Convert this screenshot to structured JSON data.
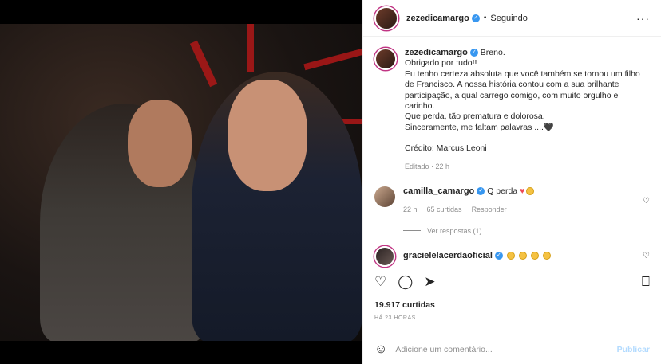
{
  "post_author": {
    "username": "zezedicamargo",
    "follow_status": "Seguindo",
    "separator": "•",
    "more": "···"
  },
  "caption": {
    "username": "zezedicamargo",
    "lines": [
      "Breno.",
      "Obrigado por tudo!!",
      "Eu tenho certeza absoluta que você também se tornou um filho de Francisco. A nossa história contou com a sua brilhante participação, a qual carrego comigo, com muito orgulho e carinho.",
      "Que perda, tão prematura e dolorosa.",
      "Sinceramente, me faltam palavras ....",
      "Crédito: Marcus Leoni"
    ],
    "meta": "Editado · 22 h"
  },
  "comments": [
    {
      "username": "camilla_camargo",
      "text": "Q perda",
      "time": "22 h",
      "likes": "65 curtidas",
      "reply": "Responder",
      "view_replies": "Ver respostas (1)"
    },
    {
      "username": "gracielelacerdaoficial",
      "text": ""
    }
  ],
  "likes_count": "19.917 curtidas",
  "timestamp": "HÁ 23 HORAS",
  "add_comment": {
    "placeholder": "Adicione um comentário...",
    "publish": "Publicar"
  },
  "colors": {
    "link_blue": "#b3dbff",
    "verified_blue": "#3897f0",
    "heart_red": "#ed4956"
  }
}
